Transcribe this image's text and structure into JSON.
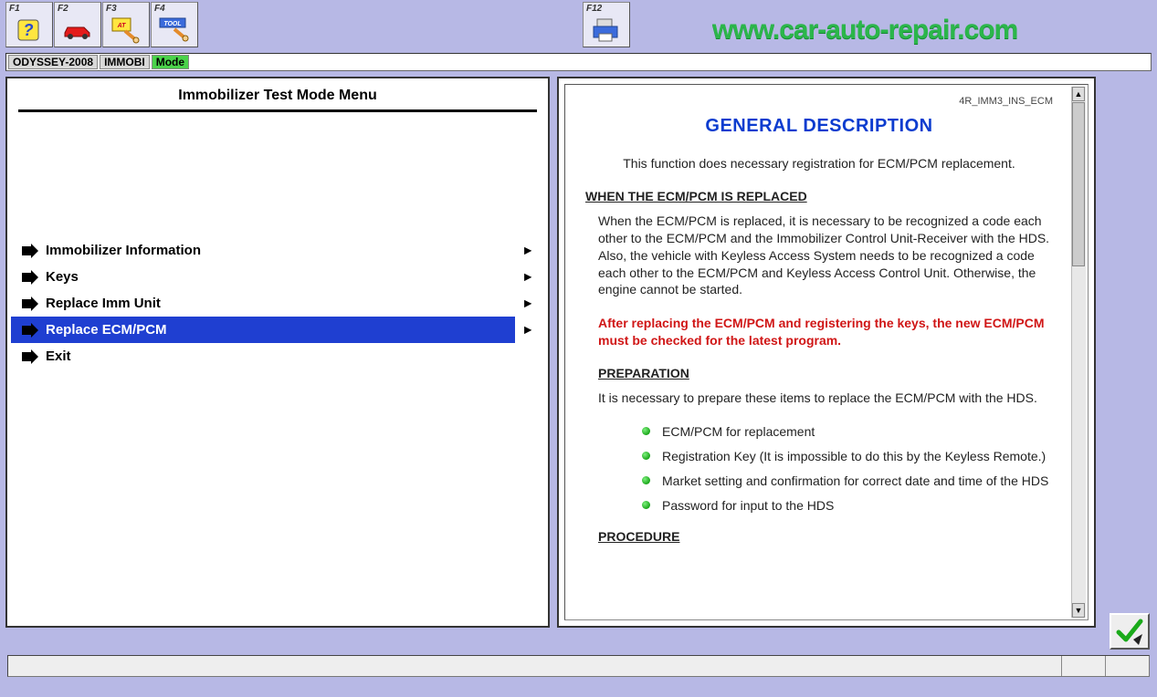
{
  "fkeys": {
    "f1": "F1",
    "f2": "F2",
    "f3": "F3",
    "f4": "F4",
    "f12": "F12",
    "f4_tool": "TOOL"
  },
  "watermark": "www.car-auto-repair.com",
  "breadcrumb": {
    "seg1": "ODYSSEY-2008",
    "seg2": "IMMOBI",
    "seg3": "Mode"
  },
  "left": {
    "title": "Immobilizer Test Mode Menu",
    "items": [
      {
        "label": "Immobilizer Information",
        "selected": false
      },
      {
        "label": "Keys",
        "selected": false
      },
      {
        "label": "Replace Imm Unit",
        "selected": false
      },
      {
        "label": "Replace ECM/PCM",
        "selected": true
      },
      {
        "label": "Exit",
        "selected": false
      }
    ]
  },
  "doc": {
    "code": "4R_IMM3_INS_ECM",
    "title": "GENERAL DESCRIPTION",
    "intro": "This function does necessary registration for ECM/PCM replacement.",
    "h1": "WHEN THE ECM/PCM IS REPLACED",
    "p1": "When the ECM/PCM is replaced, it is necessary to be recognized a code each other to the ECM/PCM and the Immobilizer Control Unit-Receiver with the HDS. Also, the vehicle with Keyless Access System needs to be recognized a code each other to the ECM/PCM and Keyless Access Control Unit. Otherwise, the engine cannot be started.",
    "warn": "After replacing the ECM/PCM and registering the keys, the new ECM/PCM must be checked for the latest program.",
    "h2": "PREPARATION",
    "p2": "It is necessary to prepare these items to replace the ECM/PCM with the HDS.",
    "bullets": [
      "ECM/PCM for replacement",
      "Registration Key (It is impossible to do this by the Keyless Remote.)",
      "Market setting and confirmation for correct date and time of the HDS",
      "Password for input to the HDS"
    ],
    "h3": "PROCEDURE"
  }
}
